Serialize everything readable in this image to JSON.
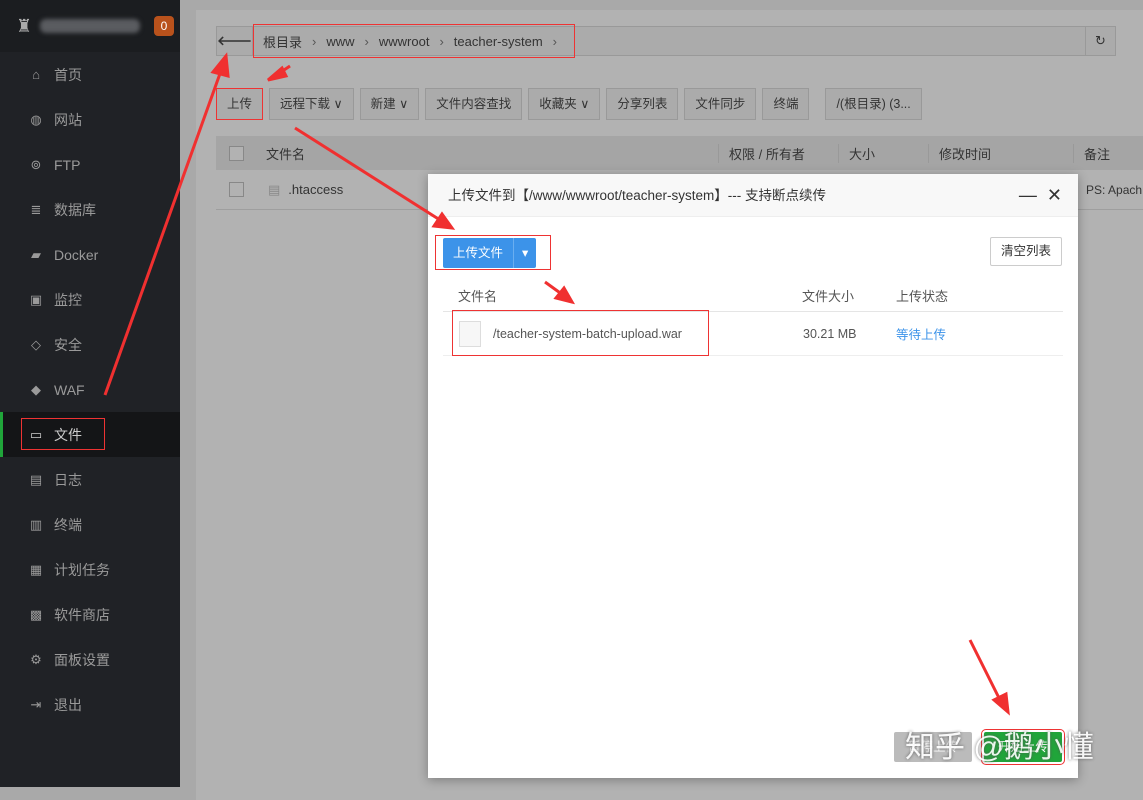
{
  "sidebar": {
    "badge": "0",
    "items": [
      {
        "label": "首页",
        "icon": "⌂"
      },
      {
        "label": "网站",
        "icon": "◍"
      },
      {
        "label": "FTP",
        "icon": "⊚"
      },
      {
        "label": "数据库",
        "icon": "≣"
      },
      {
        "label": "Docker",
        "icon": "▰"
      },
      {
        "label": "监控",
        "icon": "▣"
      },
      {
        "label": "安全",
        "icon": "◇"
      },
      {
        "label": "WAF",
        "icon": "◆"
      },
      {
        "label": "文件",
        "icon": "▭"
      },
      {
        "label": "日志",
        "icon": "▤"
      },
      {
        "label": "终端",
        "icon": "▥"
      },
      {
        "label": "计划任务",
        "icon": "▦"
      },
      {
        "label": "软件商店",
        "icon": "▩"
      },
      {
        "label": "面板设置",
        "icon": "⚙"
      },
      {
        "label": "退出",
        "icon": "⇥"
      }
    ]
  },
  "breadcrumb": [
    "根目录",
    "www",
    "wwwroot",
    "teacher-system"
  ],
  "toolbar": [
    "上传",
    "远程下载 ∨",
    "新建 ∨",
    "文件内容查找",
    "收藏夹 ∨",
    "分享列表",
    "文件同步",
    "终端",
    "/(根目录) (3..."
  ],
  "table": {
    "headers": [
      "文件名",
      "权限 / 所有者",
      "大小",
      "修改时间",
      "备注"
    ],
    "rows": [
      {
        "name": ".htaccess",
        "note": "PS: Apach"
      }
    ]
  },
  "modal": {
    "title": "上传文件到【/www/wwwroot/teacher-system】--- 支持断点续传",
    "upload_button": "上传文件",
    "clear_button": "清空列表",
    "headers": [
      "文件名",
      "文件大小",
      "上传状态"
    ],
    "files": [
      {
        "name": "/teacher-system-batch-upload.war",
        "size": "30.21 MB",
        "status": "等待上传"
      }
    ],
    "pause_button": "暂停上传",
    "start_button": "开始上传"
  },
  "watermark": "知乎 @鹅小懂",
  "colors": {
    "accent": "#3c93e9",
    "success": "#20a53a",
    "annotation": "#e33"
  }
}
